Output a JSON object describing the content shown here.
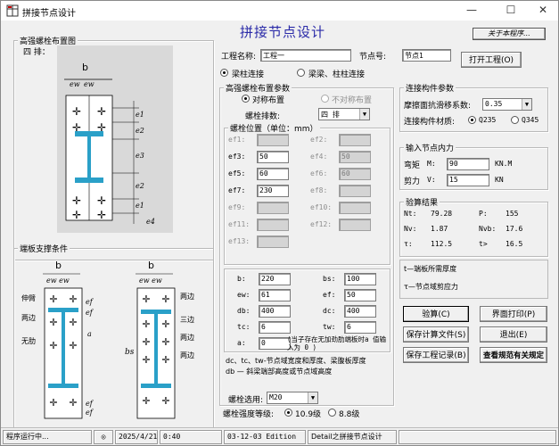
{
  "window": {
    "title": "拼接节点设计"
  },
  "header": {
    "main_title": "拼接节点设计",
    "about_label": "关于本程序..."
  },
  "project": {
    "name_label": "工程名称:",
    "name_value": "工程一",
    "node_label": "节点号:",
    "node_value": "节点1",
    "open_button": "打开工程(O)",
    "conn_type_beam_column": "梁柱连接",
    "conn_type_beam_beam": "梁梁、柱柱连接"
  },
  "left_panel": {
    "bolt_layout_title": "高强螺栓布置图",
    "rows_caption": "四 排：",
    "diagram_labels": {
      "b": "b",
      "ew": "ew",
      "ef": "ef",
      "e1": "e1",
      "e2": "e2",
      "e3": "e3",
      "e4": "e4"
    },
    "support_title": "端板支撑条件",
    "support_labels": {
      "shen_bi": "伸臂",
      "liang_bian": "两边",
      "wu_lei": "无肋",
      "san_bian": "三边",
      "bs": "bs",
      "a": "a",
      "b": "b"
    }
  },
  "bolt_params": {
    "title": "高强螺栓布置参数",
    "symmetric": "对称布置",
    "asymmetric": "不对称布置",
    "row_label": "螺栓排数:",
    "row_value": "四 排",
    "position_title": "螺栓位置（单位：mm）",
    "ef_fields": [
      {
        "label": "ef1:",
        "value": "",
        "enabled": false
      },
      {
        "label": "ef2:",
        "value": "",
        "enabled": false
      },
      {
        "label": "ef3:",
        "value": "50",
        "enabled": true
      },
      {
        "label": "ef4:",
        "value": "50",
        "enabled": false
      },
      {
        "label": "ef5:",
        "value": "60",
        "enabled": true
      },
      {
        "label": "ef6:",
        "value": "60",
        "enabled": false
      },
      {
        "label": "ef7:",
        "value": "230",
        "enabled": true
      },
      {
        "label": "ef8:",
        "value": "",
        "enabled": false
      },
      {
        "label": "ef9:",
        "value": "",
        "enabled": false
      },
      {
        "label": "ef10:",
        "value": "",
        "enabled": false
      },
      {
        "label": "ef11:",
        "value": "",
        "enabled": false
      },
      {
        "label": "ef12:",
        "value": "",
        "enabled": false
      },
      {
        "label": "ef13:",
        "value": "",
        "enabled": false
      }
    ],
    "dim_fields": [
      {
        "label": "b:",
        "value": "220"
      },
      {
        "label": "bs:",
        "value": "100"
      },
      {
        "label": "ew:",
        "value": "61"
      },
      {
        "label": "ef:",
        "value": "50"
      },
      {
        "label": "db:",
        "value": "400"
      },
      {
        "label": "dc:",
        "value": "400"
      },
      {
        "label": "tc:",
        "value": "6"
      },
      {
        "label": "tw:",
        "value": "6"
      },
      {
        "label": "a:",
        "value": "0"
      }
    ],
    "a_note": "(当子存在无加劲肋端板时a 值输入为 0 )",
    "note1": "dc、tc、tw-节点域宽度和厚度、梁腹板厚度",
    "note2": "db — 斜梁端部高度或节点域高度",
    "bolt_select_label": "螺栓选用:",
    "bolt_select_value": "M20",
    "grade_label": "螺栓强度等级:",
    "grade_109": "10.9级",
    "grade_88": "8.8级"
  },
  "conn_params": {
    "title": "连接构件参数",
    "friction_label": "摩擦面抗滑移系数:",
    "friction_value": "0.35",
    "material_label": "连接构件材质:",
    "q235": "Q235",
    "q345": "Q345"
  },
  "internal_force": {
    "title": "输入节点内力",
    "moment_label": "弯矩",
    "moment_sym": "M:",
    "moment_value": "90",
    "moment_unit": "KN.M",
    "shear_label": "剪力",
    "shear_sym": "V:",
    "shear_value": "15",
    "shear_unit": "KN"
  },
  "results": {
    "title": "验算结果",
    "rows": [
      {
        "k1": "Nt:",
        "v1": "79.28",
        "k2": "P:",
        "v2": "155"
      },
      {
        "k1": "Nv:",
        "v1": "1.87",
        "k2": "Nvb:",
        "v2": "17.6"
      },
      {
        "k1": "τ:",
        "v1": "112.5",
        "k2": "t>",
        "v2": "16.5"
      }
    ],
    "note_t": "t—端板所需厚度",
    "note_tau": "τ—节点域剪应力"
  },
  "buttons": {
    "check": "验算(C)",
    "print": "界面打印(P)",
    "save_calc": "保存计算文件(S)",
    "exit": "退出(E)",
    "save_record": "保存工程记录(B)",
    "view_spec": "查看规范有关规定"
  },
  "status": {
    "running": "程序运行中...",
    "date": "2025/4/21",
    "time": "0:40",
    "edition": "03-12-03 Edition",
    "module": "Detail之拼接节点设计"
  },
  "colors": {
    "title_blue": "#2a2aa8",
    "bolt_blue": "#2aa0c8",
    "diagram_bg": "#d9d9d9"
  }
}
